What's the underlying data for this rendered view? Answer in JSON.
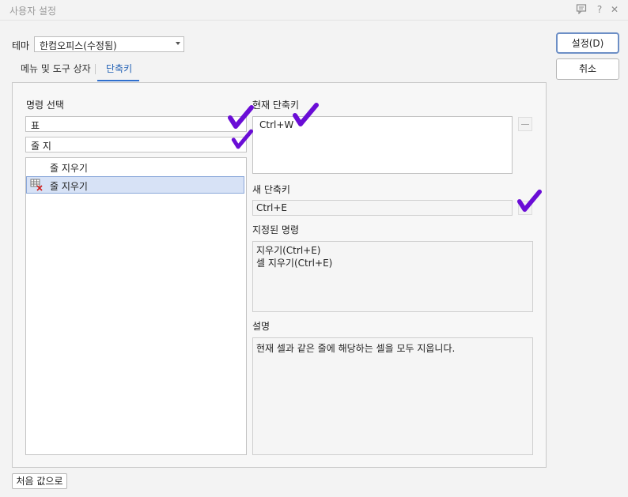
{
  "window": {
    "title": "사용자 설정"
  },
  "theme": {
    "label": "테마",
    "value": "한컴오피스(수정됨)"
  },
  "buttons": {
    "ok": "설정(D)",
    "cancel": "취소",
    "reset": "처음 값으로"
  },
  "tabs": [
    {
      "label": "메뉴 및 도구 상자",
      "active": false
    },
    {
      "label": "단축키",
      "active": true
    }
  ],
  "command": {
    "label": "명령 선택",
    "search_value": "표",
    "filter_value": "줄 지",
    "list_header": "줄 지우기",
    "items": [
      {
        "label": "줄 지우기",
        "icon": "table-delete-icon",
        "selected": true
      }
    ]
  },
  "current_shortcut": {
    "label": "현재 단축키",
    "value": "Ctrl+W"
  },
  "new_shortcut": {
    "label": "새 단축키",
    "value": "Ctrl+E"
  },
  "assigned": {
    "label": "지정된 명령",
    "lines": [
      "지우기(Ctrl+E)",
      "셀 지우기(Ctrl+E)"
    ]
  },
  "description": {
    "label": "설명",
    "text": "현재 셀과 같은 줄에 해당하는 셀을 모두 지웁니다."
  },
  "colors": {
    "accent": "#2f6fce",
    "selection": "#d7e2f6",
    "checkmark": "#6a0dd6"
  }
}
